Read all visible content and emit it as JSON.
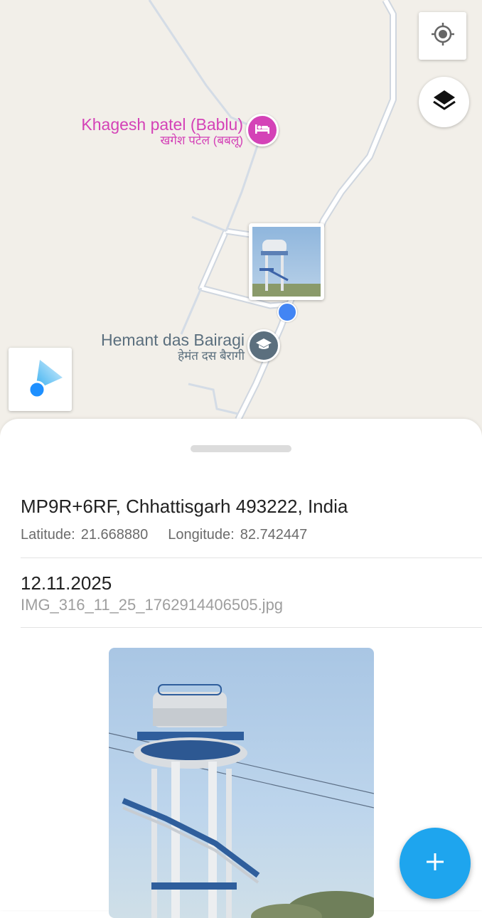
{
  "map": {
    "pois": [
      {
        "name": "Khagesh patel (Bablu)",
        "name_local": "खगेश पटेल (बबलू)",
        "icon": "hotel-icon",
        "color": "#d442b7"
      },
      {
        "name": "Hemant das Bairagi",
        "name_local": "हेमंत दस बैरागी",
        "icon": "school-icon",
        "color": "#5b6f7e"
      }
    ],
    "controls": {
      "locate_icon": "my-location-icon",
      "layers_icon": "layers-icon",
      "compass_icon": "compass-direction-icon"
    }
  },
  "sheet": {
    "address": "MP9R+6RF, Chhattisgarh 493222, India",
    "latitude_label": "Latitude:",
    "latitude": "21.668880",
    "longitude_label": "Longitude:",
    "longitude": "82.742447",
    "date": "12.11.2025",
    "filename": "IMG_316_11_25_1762914406505.jpg"
  },
  "fab": {
    "icon": "plus-icon",
    "color": "#1ea5ee"
  }
}
